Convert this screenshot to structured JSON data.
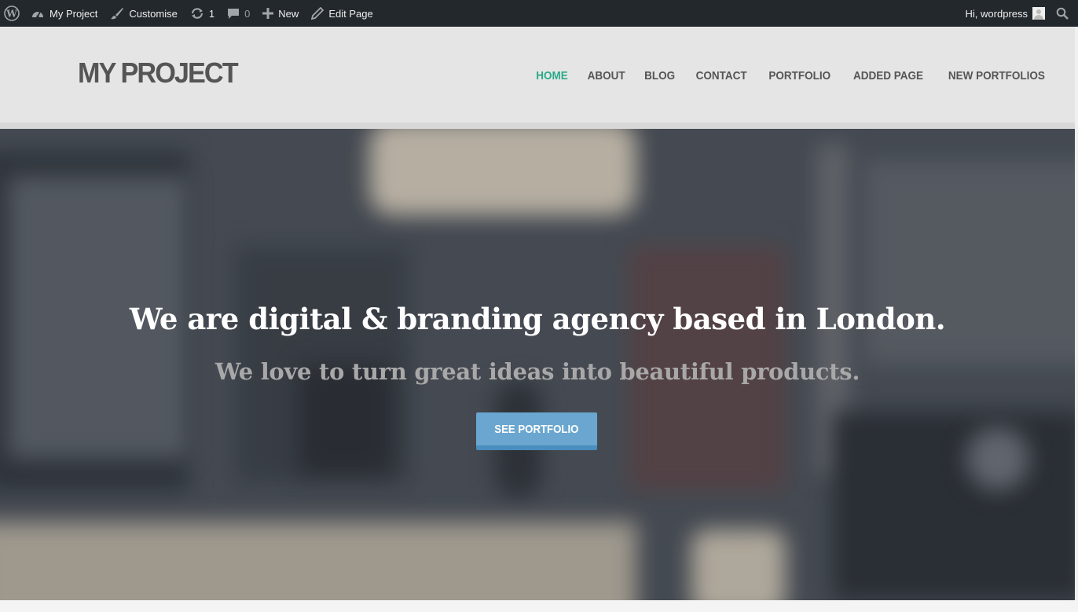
{
  "admin_bar": {
    "site_name": "My Project",
    "customise_label": "Customise",
    "updates_count": "1",
    "comments_count": "0",
    "new_label": "New",
    "edit_page_label": "Edit Page",
    "greeting": "Hi, wordpress",
    "icons": [
      "wordpress-logo-icon",
      "dashboard-icon",
      "paintbrush-icon",
      "updates-icon",
      "comment-icon",
      "plus-icon",
      "pencil-icon",
      "avatar",
      "search-icon"
    ]
  },
  "header": {
    "site_title": "MY PROJECT",
    "nav": [
      {
        "label": "HOME",
        "active": true
      },
      {
        "label": "ABOUT",
        "active": false
      },
      {
        "label": "BLOG",
        "active": false
      },
      {
        "label": "CONTACT",
        "active": false
      },
      {
        "label": "PORTFOLIO",
        "active": false
      },
      {
        "label": "ADDED PAGE",
        "active": false
      },
      {
        "label": "NEW PORTFOLIOS",
        "active": false
      }
    ]
  },
  "hero": {
    "heading": "We are digital & branding agency based in London.",
    "subheading": "We love to turn great ideas into beautiful products.",
    "button_label": "SEE PORTFOLIO"
  },
  "colors": {
    "admin_bar_bg": "#23282d",
    "header_bg": "#e5e5e5",
    "nav_active": "#2aaa8a",
    "nav_text": "#555555",
    "button_bg": "#6aa6cf",
    "button_border": "#4a8dbf"
  }
}
